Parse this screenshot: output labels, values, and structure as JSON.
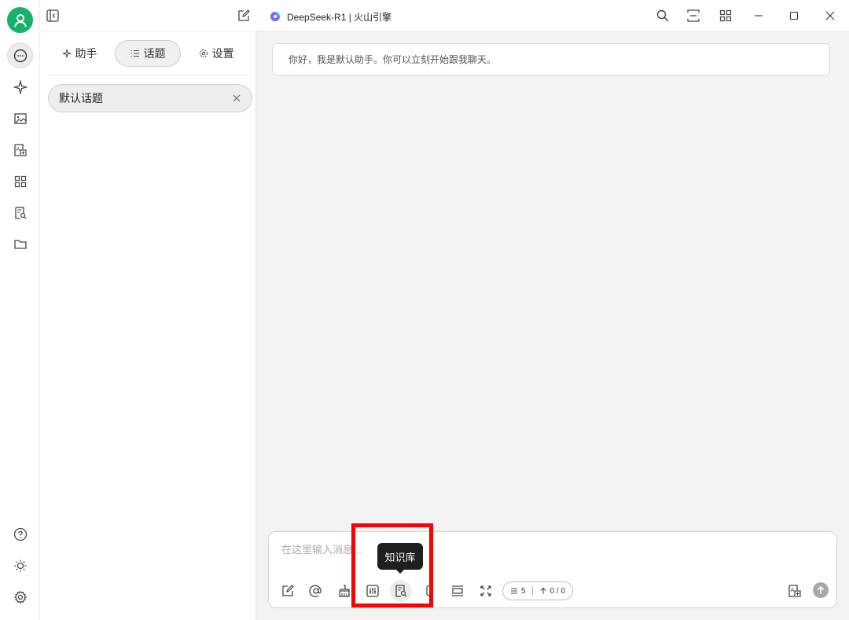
{
  "window": {
    "title": "DeepSeek-R1 | 火山引擎"
  },
  "rail": {
    "items": [
      {
        "icon": "chat-icon",
        "active": true
      },
      {
        "icon": "sparkle-icon"
      },
      {
        "icon": "image-icon"
      },
      {
        "icon": "translate-icon"
      },
      {
        "icon": "apps-grid-icon"
      },
      {
        "icon": "knowledge-base-icon"
      },
      {
        "icon": "folder-icon"
      }
    ],
    "bottom_items": [
      {
        "icon": "help-icon"
      },
      {
        "icon": "sun-icon"
      },
      {
        "icon": "settings-gear-icon"
      }
    ]
  },
  "panel": {
    "tabs": [
      {
        "label": "助手",
        "icon": "sparkle-icon"
      },
      {
        "label": "话题",
        "icon": "list-icon",
        "active": true
      },
      {
        "label": "设置",
        "icon": "gear-icon"
      }
    ],
    "topics": [
      {
        "label": "默认话题"
      }
    ]
  },
  "main": {
    "greeting": "你好，我是默认助手。你可以立刻开始跟我聊天。",
    "composer": {
      "placeholder": "在这里输入消息...",
      "context_count": "5",
      "token_count": "0 / 0"
    },
    "tooltip": "知识库"
  },
  "colors": {
    "accent": "#17b26a",
    "highlight": "#ff0000"
  }
}
